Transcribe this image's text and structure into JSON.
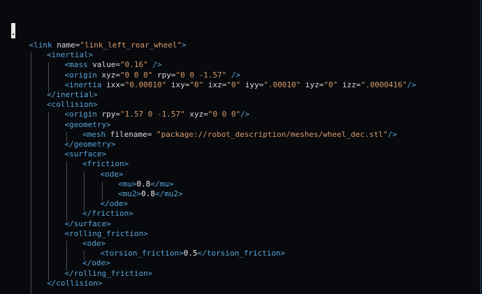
{
  "colors": {
    "background": "#07090c",
    "tag": "#5aa5da",
    "attribute": "#dcdcdc",
    "value": "#d99a6c",
    "text": "#f0f0f0"
  },
  "lines": [
    {
      "indent": 1,
      "parts": [
        {
          "t": "<link ",
          "c": "tag"
        },
        {
          "t": "name",
          "c": "attr"
        },
        {
          "t": "=",
          "c": "eq"
        },
        {
          "t": "\"link_left_rear_wheel\"",
          "c": "val"
        },
        {
          "t": ">",
          "c": "tag"
        }
      ]
    },
    {
      "indent": 2,
      "parts": [
        {
          "t": "<inertial>",
          "c": "tag"
        }
      ]
    },
    {
      "indent": 3,
      "parts": [
        {
          "t": "<mass ",
          "c": "tag"
        },
        {
          "t": "value",
          "c": "attr"
        },
        {
          "t": "=",
          "c": "eq"
        },
        {
          "t": "\"0.16\"",
          "c": "val"
        },
        {
          "t": " />",
          "c": "tag"
        }
      ]
    },
    {
      "indent": 3,
      "parts": [
        {
          "t": "<origin ",
          "c": "tag"
        },
        {
          "t": "xyz",
          "c": "attr"
        },
        {
          "t": "=",
          "c": "eq"
        },
        {
          "t": "\"0 0 0\"",
          "c": "val"
        },
        {
          "t": " ",
          "c": "attr"
        },
        {
          "t": "rpy",
          "c": "attr"
        },
        {
          "t": "=",
          "c": "eq"
        },
        {
          "t": "\"0 0 -1.57\"",
          "c": "val"
        },
        {
          "t": " />",
          "c": "tag"
        }
      ]
    },
    {
      "indent": 3,
      "parts": [
        {
          "t": "<inertia ",
          "c": "tag"
        },
        {
          "t": "ixx",
          "c": "attr"
        },
        {
          "t": "=",
          "c": "eq"
        },
        {
          "t": "\"0.00010\"",
          "c": "val"
        },
        {
          "t": " ixy",
          "c": "attr"
        },
        {
          "t": "=",
          "c": "eq"
        },
        {
          "t": "\"0\"",
          "c": "val"
        },
        {
          "t": " ixz",
          "c": "attr"
        },
        {
          "t": "=",
          "c": "eq"
        },
        {
          "t": "\"0\"",
          "c": "val"
        },
        {
          "t": " iyy",
          "c": "attr"
        },
        {
          "t": "=",
          "c": "eq"
        },
        {
          "t": "\".00010\"",
          "c": "val"
        },
        {
          "t": " iyz",
          "c": "attr"
        },
        {
          "t": "=",
          "c": "eq"
        },
        {
          "t": "\"0\"",
          "c": "val"
        },
        {
          "t": " izz",
          "c": "attr"
        },
        {
          "t": "=",
          "c": "eq"
        },
        {
          "t": "\".0000416\"",
          "c": "val"
        },
        {
          "t": "/>",
          "c": "tag"
        }
      ]
    },
    {
      "indent": 2,
      "parts": [
        {
          "t": "</inertial>",
          "c": "tag"
        }
      ]
    },
    {
      "indent": 2,
      "parts": [
        {
          "t": "<collision>",
          "c": "tag"
        }
      ]
    },
    {
      "indent": 3,
      "parts": [
        {
          "t": "<origin ",
          "c": "tag"
        },
        {
          "t": "rpy",
          "c": "attr"
        },
        {
          "t": "=",
          "c": "eq"
        },
        {
          "t": "\"1.57 0 -1.57\"",
          "c": "val"
        },
        {
          "t": " xyz",
          "c": "attr"
        },
        {
          "t": "=",
          "c": "eq"
        },
        {
          "t": "\"0 0 0\"",
          "c": "val"
        },
        {
          "t": "/>",
          "c": "tag"
        }
      ]
    },
    {
      "indent": 3,
      "parts": [
        {
          "t": "<geometry>",
          "c": "tag"
        }
      ]
    },
    {
      "indent": 4,
      "parts": [
        {
          "t": "<mesh ",
          "c": "tag"
        },
        {
          "t": "filename",
          "c": "attr"
        },
        {
          "t": "= ",
          "c": "eq"
        },
        {
          "t": "\"package://robot_description/meshes/wheel_dec.stl\"",
          "c": "val"
        },
        {
          "t": "/>",
          "c": "tag"
        }
      ]
    },
    {
      "indent": 3,
      "parts": [
        {
          "t": "</geometry>",
          "c": "tag"
        }
      ]
    },
    {
      "indent": 3,
      "parts": [
        {
          "t": "<surface>",
          "c": "tag"
        }
      ]
    },
    {
      "indent": 4,
      "parts": [
        {
          "t": "<friction>",
          "c": "tag"
        }
      ]
    },
    {
      "indent": 5,
      "parts": [
        {
          "t": "<ode>",
          "c": "tag"
        }
      ]
    },
    {
      "indent": 6,
      "parts": [
        {
          "t": "<mu>",
          "c": "tag"
        },
        {
          "t": "0.8",
          "c": "txt"
        },
        {
          "t": "</mu>",
          "c": "tag"
        }
      ]
    },
    {
      "indent": 6,
      "parts": [
        {
          "t": "<mu2>",
          "c": "tag"
        },
        {
          "t": "0.8",
          "c": "txt"
        },
        {
          "t": "</mu2>",
          "c": "tag"
        }
      ]
    },
    {
      "indent": 5,
      "parts": [
        {
          "t": "</ode>",
          "c": "tag"
        }
      ]
    },
    {
      "indent": 4,
      "parts": [
        {
          "t": "</friction>",
          "c": "tag"
        }
      ]
    },
    {
      "indent": 3,
      "parts": [
        {
          "t": "</surface>",
          "c": "tag"
        }
      ]
    },
    {
      "indent": 3,
      "parts": [
        {
          "t": "<rolling_friction>",
          "c": "tag"
        }
      ]
    },
    {
      "indent": 4,
      "parts": [
        {
          "t": "<ode>",
          "c": "tag"
        }
      ]
    },
    {
      "indent": 5,
      "parts": [
        {
          "t": "<torsion_friction>",
          "c": "tag"
        },
        {
          "t": "0.5",
          "c": "txt"
        },
        {
          "t": "</torsion_friction>",
          "c": "tag"
        }
      ]
    },
    {
      "indent": 4,
      "parts": [
        {
          "t": "</ode>",
          "c": "tag"
        }
      ]
    },
    {
      "indent": 3,
      "parts": [
        {
          "t": "</rolling_friction>",
          "c": "tag"
        }
      ]
    },
    {
      "indent": 2,
      "parts": [
        {
          "t": "</collision>",
          "c": "tag"
        }
      ]
    }
  ]
}
